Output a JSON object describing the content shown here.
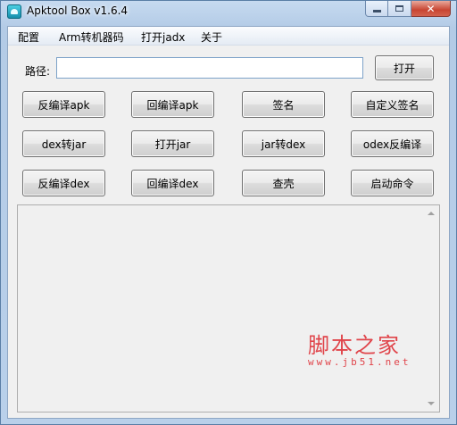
{
  "window": {
    "title": "Apktool Box v1.6.4",
    "close_glyph": "✕"
  },
  "menu": [
    "配置",
    "Arm转机器码",
    "打开jadx",
    "关于"
  ],
  "path": {
    "label": "路径:",
    "value": "",
    "open_button": "打开"
  },
  "buttons": {
    "row1": [
      "反编译apk",
      "回编译apk",
      "签名",
      "自定义签名"
    ],
    "row2": [
      "dex转jar",
      "打开jar",
      "jar转dex",
      "odex反编译"
    ],
    "row3": [
      "反编译dex",
      "回编译dex",
      "查壳",
      "启动命令"
    ]
  },
  "watermark": {
    "text": "脚本之家",
    "url": "www.jb51.net"
  },
  "icons": [
    "app-icon",
    "minimize-icon",
    "maximize-icon",
    "close-icon",
    "scroll-up-icon",
    "scroll-down-icon"
  ]
}
